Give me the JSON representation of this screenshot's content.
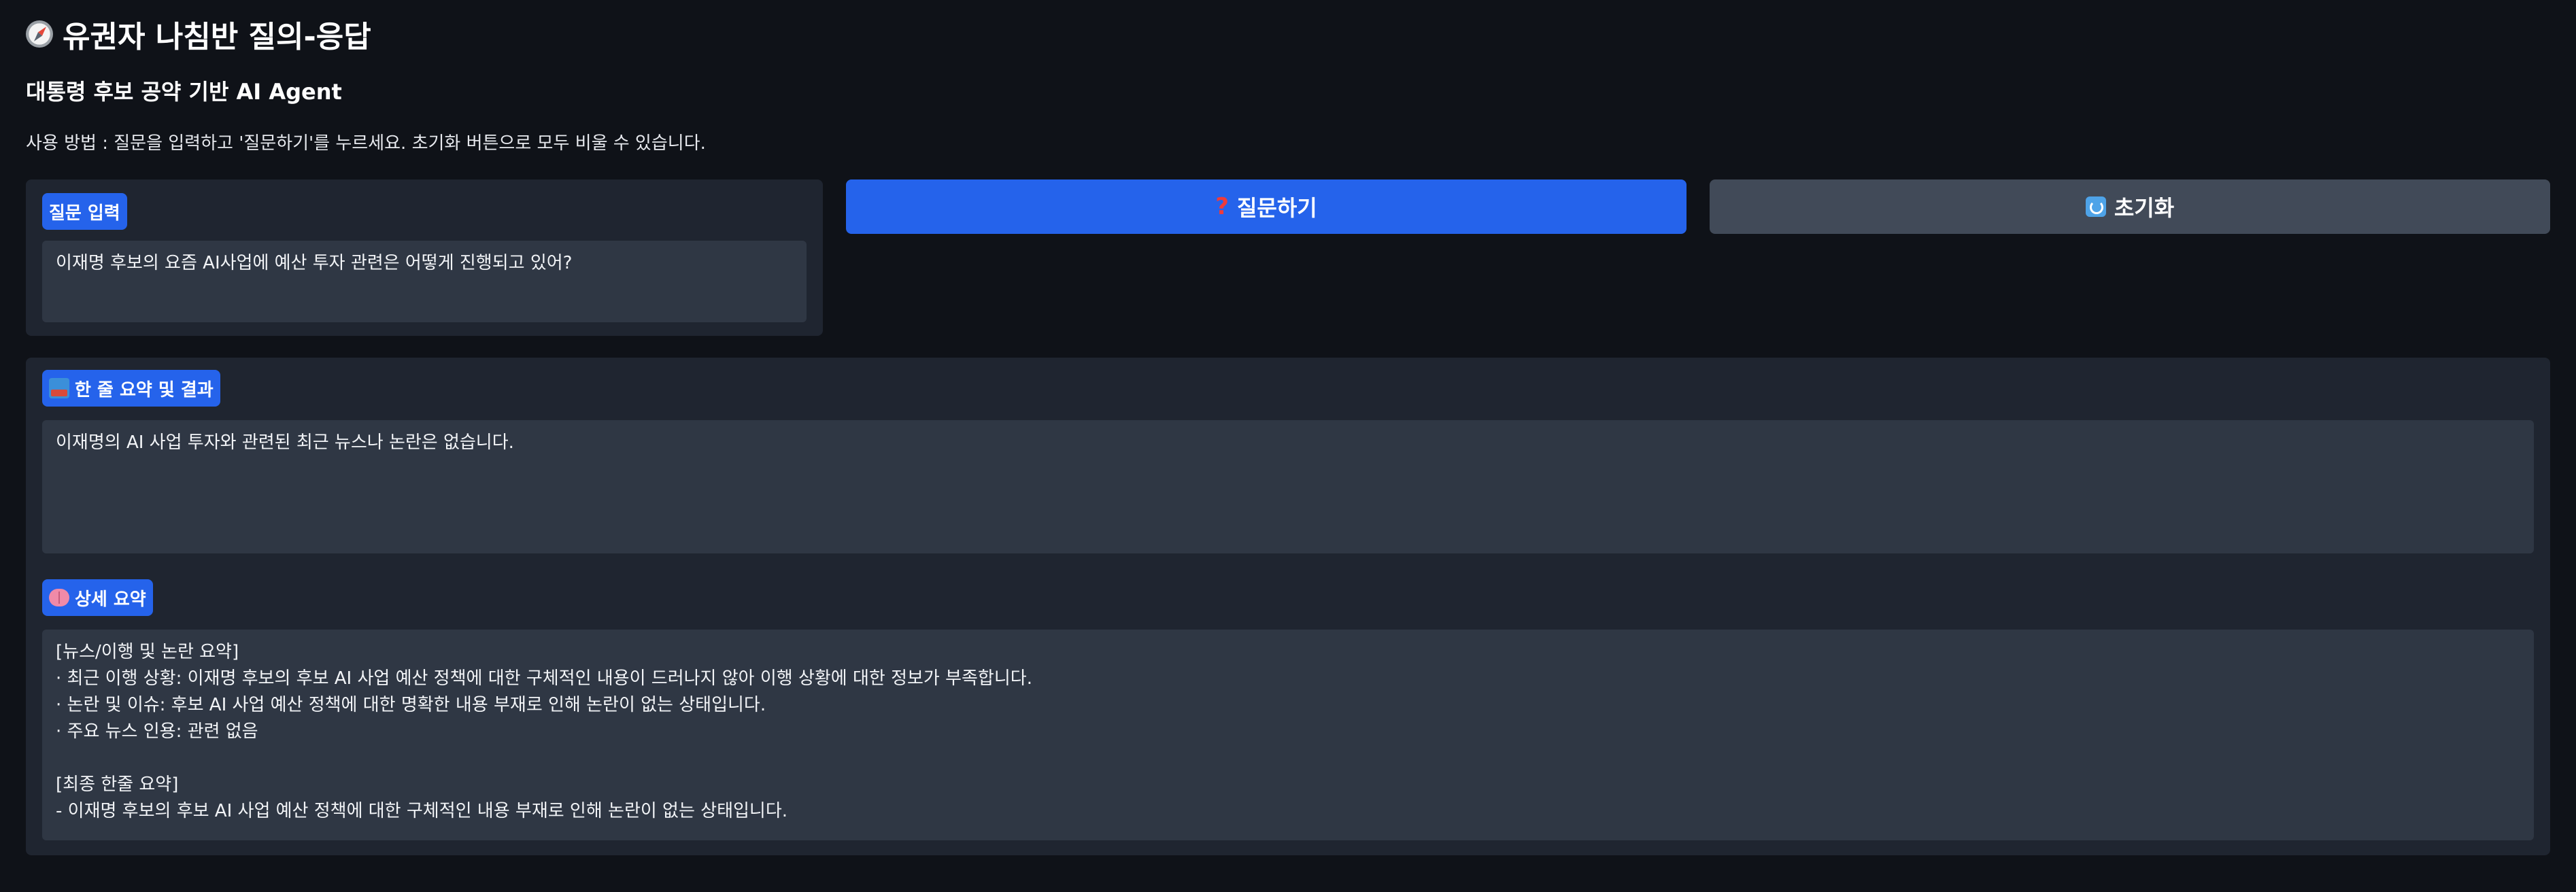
{
  "header": {
    "title": "유권자 나침반 질의-응답",
    "title_icon": "compass-icon",
    "subtitle": "대통령 후보 공약 기반 AI Agent",
    "usage": "사용 방법 : 질문을 입력하고 '질문하기'를 누르세요. 초기화 버튼으로 모두 비울 수 있습니다."
  },
  "question": {
    "label": "질문 입력",
    "value": "이재명 후보의 요즘 AI사업에 예산 투자 관련은 어떻게 진행되고 있어?"
  },
  "buttons": {
    "ask_label": "질문하기",
    "ask_icon": "question-mark-icon",
    "reset_label": "초기화",
    "reset_icon": "reset-icon"
  },
  "results": {
    "summary_label": "한 줄 요약 및 결과",
    "summary_icon": "inbox-tray-icon",
    "summary_value": "이재명의 AI 사업 투자와 관련된 최근 뉴스나 논란은 없습니다.",
    "detail_label": "상세 요약",
    "detail_icon": "brain-icon",
    "detail_value": "[뉴스/이행 및 논란 요약]\n· 최근 이행 상황: 이재명 후보의 후보 AI 사업 예산 정책에 대한 구체적인 내용이 드러나지 않아 이행 상황에 대한 정보가 부족합니다.\n· 논란 및 이슈: 후보 AI 사업 예산 정책에 대한 명확한 내용 부재로 인해 논란이 없는 상태입니다.\n· 주요 뉴스 인용: 관련 없음\n\n[최종 한줄 요약]\n- 이재명 후보의 후보 AI 사업 예산 정책에 대한 구체적인 내용 부재로 인해 논란이 없는 상태입니다."
  },
  "colors": {
    "background": "#0f1218",
    "panel": "#1f2530",
    "field": "#2f3744",
    "accent": "#2563eb",
    "reset_button": "#414a58"
  }
}
